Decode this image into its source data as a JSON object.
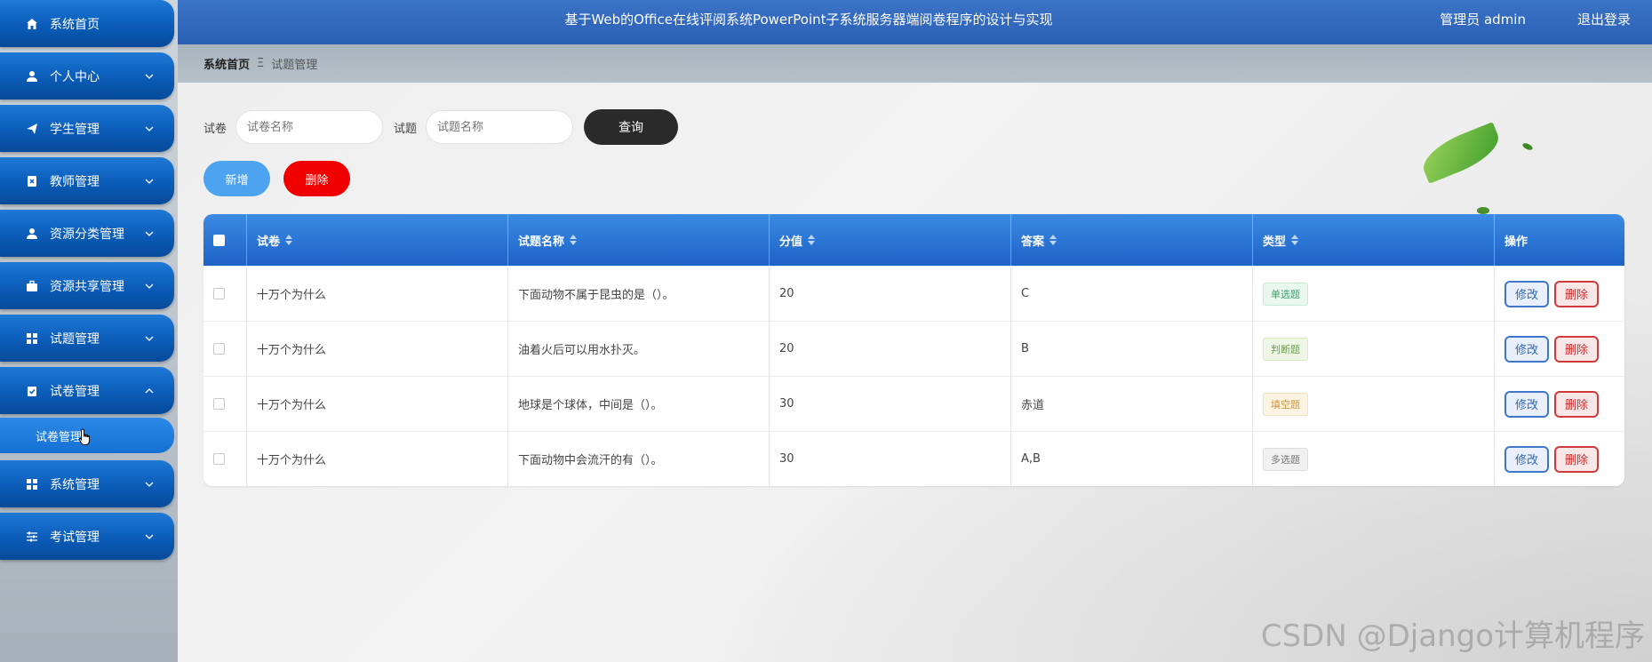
{
  "sidebar": {
    "items": [
      {
        "label": "系统首页",
        "icon": "home-icon"
      },
      {
        "label": "个人中心",
        "icon": "user-icon"
      },
      {
        "label": "学生管理",
        "icon": "send-icon"
      },
      {
        "label": "教师管理",
        "icon": "id-card-icon"
      },
      {
        "label": "资源分类管理",
        "icon": "user-icon"
      },
      {
        "label": "资源共享管理",
        "icon": "briefcase-icon"
      },
      {
        "label": "试题管理",
        "icon": "grid-icon"
      },
      {
        "label": "试卷管理",
        "icon": "clipboard-icon"
      },
      {
        "label": "系统管理",
        "icon": "grid-icon"
      },
      {
        "label": "考试管理",
        "icon": "sliders-icon"
      }
    ],
    "sub_item": "试卷管理"
  },
  "header": {
    "title": "基于Web的Office在线评阅系统PowerPoint子系统服务器端阅卷程序的设计与实现",
    "user": "管理员 admin",
    "logout": "退出登录"
  },
  "breadcrumb": {
    "home": "系统首页",
    "separator": "Ξ",
    "current": "试题管理"
  },
  "search": {
    "paper_label": "试卷",
    "paper_placeholder": "试卷名称",
    "question_label": "试题",
    "question_placeholder": "试题名称",
    "query_button": "查询"
  },
  "actions": {
    "add": "新增",
    "delete": "删除"
  },
  "table": {
    "headers": [
      "试卷",
      "试题名称",
      "分值",
      "答案",
      "类型",
      "操作"
    ],
    "rows": [
      {
        "paper": "十万个为什么",
        "question": "下面动物不属于昆虫的是（）。",
        "score": "20",
        "answer": "C",
        "type": "单选题",
        "type_color": "green"
      },
      {
        "paper": "十万个为什么",
        "question": "油着火后可以用水扑灭。",
        "score": "20",
        "answer": "B",
        "type": "判断题",
        "type_color": "lgreen"
      },
      {
        "paper": "十万个为什么",
        "question": "地球是个球体，中间是（）。",
        "score": "30",
        "answer": "赤道",
        "type": "填空题",
        "type_color": "orange"
      },
      {
        "paper": "十万个为什么",
        "question": "下面动物中会流汗的有（）。",
        "score": "30",
        "answer": "A,B",
        "type": "多选题",
        "type_color": "gray"
      }
    ],
    "edit_label": "修改",
    "delete_label": "删除"
  },
  "watermark": "CSDN @Django计算机程序",
  "colors": {
    "nav_blue": "#0b5cb8",
    "header_blue": "#2a5fb4",
    "add_button": "#4da3f0",
    "delete_button": "#f10000",
    "query_button": "#2a2a2a"
  }
}
